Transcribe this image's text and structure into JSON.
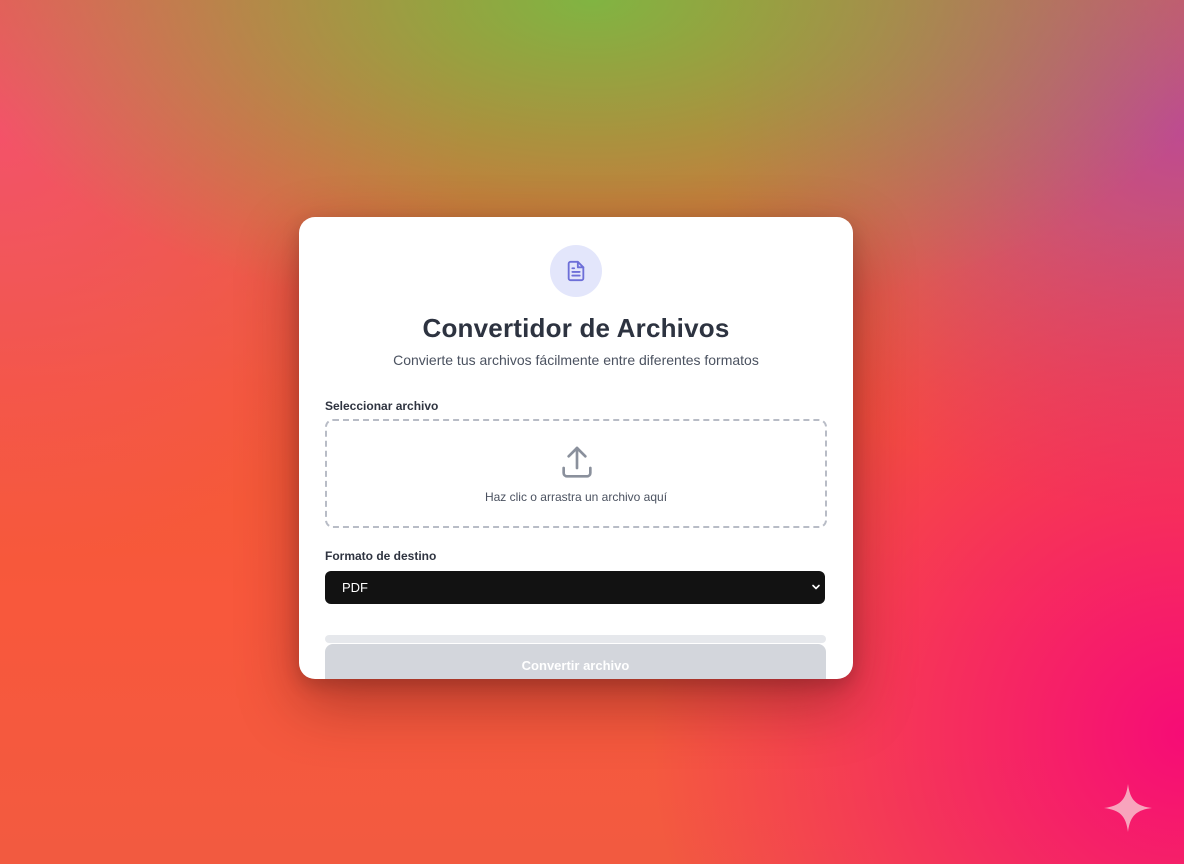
{
  "converter": {
    "title": "Convertidor de Archivos",
    "subtitle": "Convierte tus archivos fácilmente entre diferentes formatos",
    "logo_icon": "document-icon",
    "file_label": "Seleccionar archivo",
    "dropzone_icon": "upload-icon",
    "dropzone_text": "Haz clic o arrastra un archivo aquí",
    "format_label": "Formato de destino",
    "format_selected": "PDF",
    "progress": 0,
    "convert_button": "Convertir archivo",
    "convert_button_state": "disabled"
  },
  "corner_icon": "sparkle-icon",
  "colors": {
    "accent": "#6d6fd8",
    "accent_light": "#e3e6fb",
    "select_background": "#121212",
    "disabled_button": "#d3d6dc"
  }
}
